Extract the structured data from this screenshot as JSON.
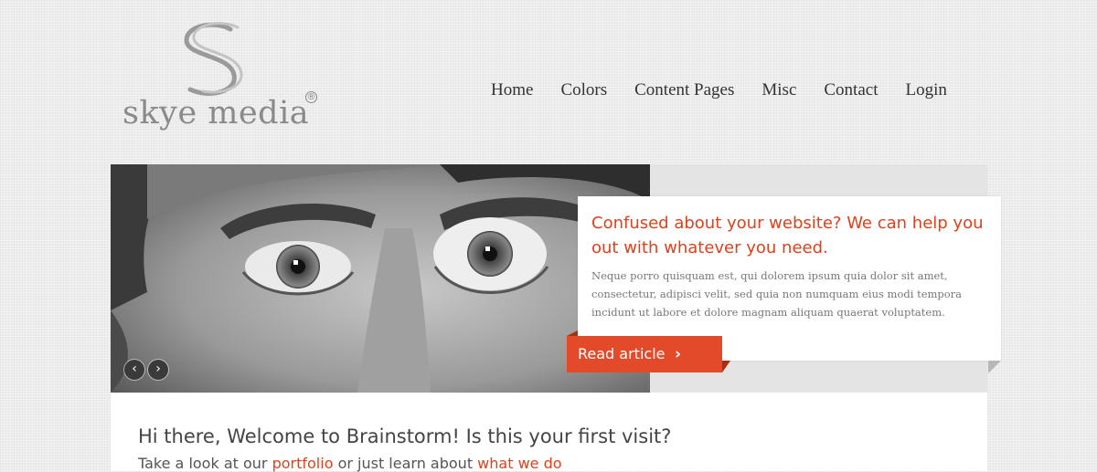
{
  "brand": {
    "name": "skye media",
    "registered_mark": "®"
  },
  "nav": {
    "items": [
      "Home",
      "Colors",
      "Content Pages",
      "Misc",
      "Contact",
      "Login"
    ]
  },
  "slider": {
    "prev_icon": "chevron-left-icon",
    "next_icon": "chevron-right-icon",
    "prev_glyph": "‹",
    "next_glyph": "›",
    "caption": {
      "title": "Confused about your website? We can help you out with whatever you need.",
      "body": "Neque porro quisquam est, qui dolorem ipsum quia dolor sit amet, consectetur, adipisci velit, sed quia non numquam eius modi tempora incidunt ut labore et dolore magnam aliquam quaerat voluptatem.",
      "button_label": "Read article",
      "button_icon": "chevron-right-icon",
      "button_glyph": "›"
    }
  },
  "welcome": {
    "heading": "Hi there, Welcome to Brainstorm! Is this your first visit?",
    "sub_prefix": "Take a look at our ",
    "link_portfolio": "portfolio",
    "sub_middle": " or just learn about ",
    "link_what_we_do": "what we do"
  },
  "colors": {
    "accent": "#e24a2a",
    "accent_text": "#e0401c",
    "background": "#ececec"
  }
}
